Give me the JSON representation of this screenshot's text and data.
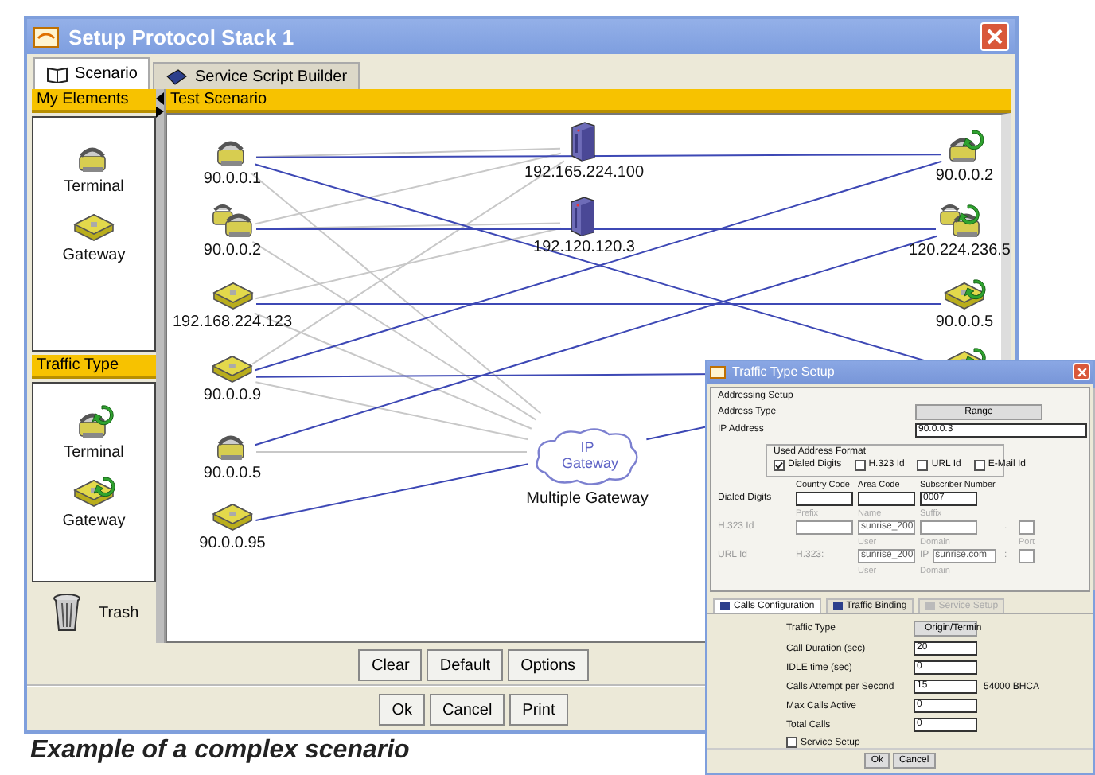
{
  "window": {
    "title": "Setup Protocol Stack 1"
  },
  "tabs": [
    {
      "label": "Scenario",
      "selected": true
    },
    {
      "label": "Service Script Builder",
      "selected": false
    }
  ],
  "my_elements": {
    "title": "My Elements",
    "items": [
      {
        "label": "Terminal",
        "kind": "phone"
      },
      {
        "label": "Gateway",
        "kind": "gateway"
      }
    ]
  },
  "traffic_type": {
    "title": "Traffic Type",
    "items": [
      {
        "label": "Terminal",
        "kind": "phone-sync"
      },
      {
        "label": "Gateway",
        "kind": "gateway-sync"
      }
    ]
  },
  "trash": {
    "label": "Trash"
  },
  "scenario": {
    "title": "Test Scenario",
    "nodes": [
      {
        "label": "90.0.0.1",
        "kind": "phone"
      },
      {
        "label": "90.0.0.2",
        "kind": "phones"
      },
      {
        "label": "192.168.224.123",
        "kind": "gateway"
      },
      {
        "label": "90.0.0.9",
        "kind": "gateway"
      },
      {
        "label": "90.0.0.5",
        "kind": "phone"
      },
      {
        "label": "90.0.0.95",
        "kind": "gateway"
      },
      {
        "label": "192.165.224.100",
        "kind": "server"
      },
      {
        "label": "192.120.120.3",
        "kind": "server"
      },
      {
        "label": "Multiple Gateway",
        "kind": "cloud",
        "text": "IP Gateway"
      },
      {
        "label": "90.0.0.2",
        "kind": "phone-sync"
      },
      {
        "label": "120.224.236.5",
        "kind": "phones-sync"
      },
      {
        "label": "90.0.0.5",
        "kind": "gateway-sync"
      },
      {
        "kind": "gateway-sync"
      }
    ]
  },
  "scenario_buttons": [
    "Clear",
    "Default",
    "Options"
  ],
  "window_buttons": [
    "Ok",
    "Cancel",
    "Print"
  ],
  "dialog": {
    "title": "Traffic Type Setup",
    "addressing": {
      "title": "Addressing Setup",
      "address_type": {
        "label": "Address Type",
        "value": "Range"
      },
      "ip_address": {
        "label": "IP Address",
        "value": "90.0.0.3"
      },
      "format": {
        "title": "Used Address Format",
        "options": [
          {
            "label": "Dialed Digits",
            "checked": true
          },
          {
            "label": "H.323 Id",
            "checked": false
          },
          {
            "label": "URL Id",
            "checked": false
          },
          {
            "label": "E-Mail Id",
            "checked": false
          }
        ]
      },
      "rows": [
        {
          "label": "Dialed Digits",
          "disabled": false,
          "cells": [
            {
              "kind": "field",
              "heading": "Country Code"
            },
            {
              "kind": "field",
              "heading": "Area Code"
            },
            {
              "kind": "field",
              "heading": "Subscriber Number",
              "value": "0007"
            }
          ]
        },
        {
          "label": "H.323 Id",
          "disabled": true,
          "cells": [
            {
              "kind": "field",
              "heading": "Prefix"
            },
            {
              "kind": "field",
              "heading": "Name",
              "value": "sunrise_200"
            },
            {
              "kind": "field",
              "heading": "Suffix"
            },
            {
              "kind": "text",
              "text": "."
            },
            {
              "kind": "small-field"
            }
          ]
        },
        {
          "label": "URL Id",
          "disabled": true,
          "cells": [
            {
              "kind": "text",
              "text": "H.323:"
            },
            {
              "kind": "field",
              "heading": "User",
              "value": "sunrise_200"
            },
            {
              "kind": "labeled-field",
              "heading": "Domain",
              "label": "IP",
              "value": "sunrise.com"
            },
            {
              "kind": "text",
              "text": ":"
            },
            {
              "kind": "small-field",
              "heading": "Port"
            }
          ]
        },
        {
          "disabled": true,
          "cells": [
            {
              "kind": "hidden"
            },
            {
              "kind": "hidden",
              "heading": "User"
            },
            {
              "kind": "hidden",
              "heading": "Domain"
            }
          ]
        }
      ]
    },
    "tabs": [
      {
        "label": "Calls Configuration",
        "selected": true,
        "disabled": false
      },
      {
        "label": "Traffic Binding",
        "selected": false,
        "disabled": false
      },
      {
        "label": "Service Setup",
        "selected": false,
        "disabled": true
      }
    ],
    "form": [
      {
        "label": "Traffic Type",
        "kind": "button",
        "value": "Origin/Termin"
      },
      {
        "label": "Call Duration (sec)",
        "kind": "field",
        "value": "20"
      },
      {
        "label": "IDLE time (sec)",
        "kind": "field",
        "value": "0"
      },
      {
        "label": "Calls Attempt per Second",
        "kind": "field",
        "value": "15",
        "note": "54000 BHCA"
      },
      {
        "label": "Max Calls Active",
        "kind": "field",
        "value": "0"
      },
      {
        "label": "Total Calls",
        "kind": "field",
        "value": "0"
      }
    ],
    "service_setup": {
      "label": "Service Setup",
      "checked": false
    },
    "buttons": [
      "Ok",
      "Cancel"
    ]
  },
  "caption": "Example of a complex scenario"
}
